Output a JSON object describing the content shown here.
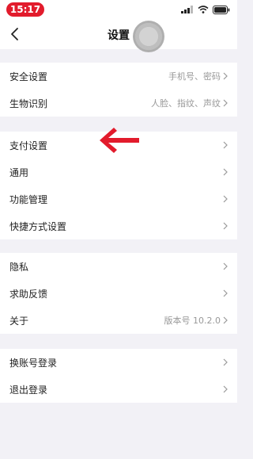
{
  "status_bar": {
    "time": "15:17"
  },
  "nav": {
    "title": "设置"
  },
  "sections": [
    {
      "rows": [
        {
          "label": "安全设置",
          "value": "手机号、密码"
        },
        {
          "label": "生物识别",
          "value": "人脸、指纹、声纹"
        }
      ]
    },
    {
      "rows": [
        {
          "label": "支付设置",
          "value": ""
        },
        {
          "label": "通用",
          "value": ""
        },
        {
          "label": "功能管理",
          "value": ""
        },
        {
          "label": "快捷方式设置",
          "value": ""
        }
      ]
    },
    {
      "rows": [
        {
          "label": "隐私",
          "value": ""
        },
        {
          "label": "求助反馈",
          "value": ""
        },
        {
          "label": "关于",
          "value": "版本号 10.2.0"
        }
      ]
    },
    {
      "rows": [
        {
          "label": "换账号登录",
          "value": ""
        },
        {
          "label": "退出登录",
          "value": ""
        }
      ]
    }
  ],
  "icons": {
    "back": "chevron-left-icon",
    "row_chevron": "chevron-right-icon",
    "annotation": "red-arrow-icon"
  },
  "colors": {
    "accent": "#e21b2c",
    "background": "#f2f1f6",
    "secondary_text": "#999999"
  }
}
